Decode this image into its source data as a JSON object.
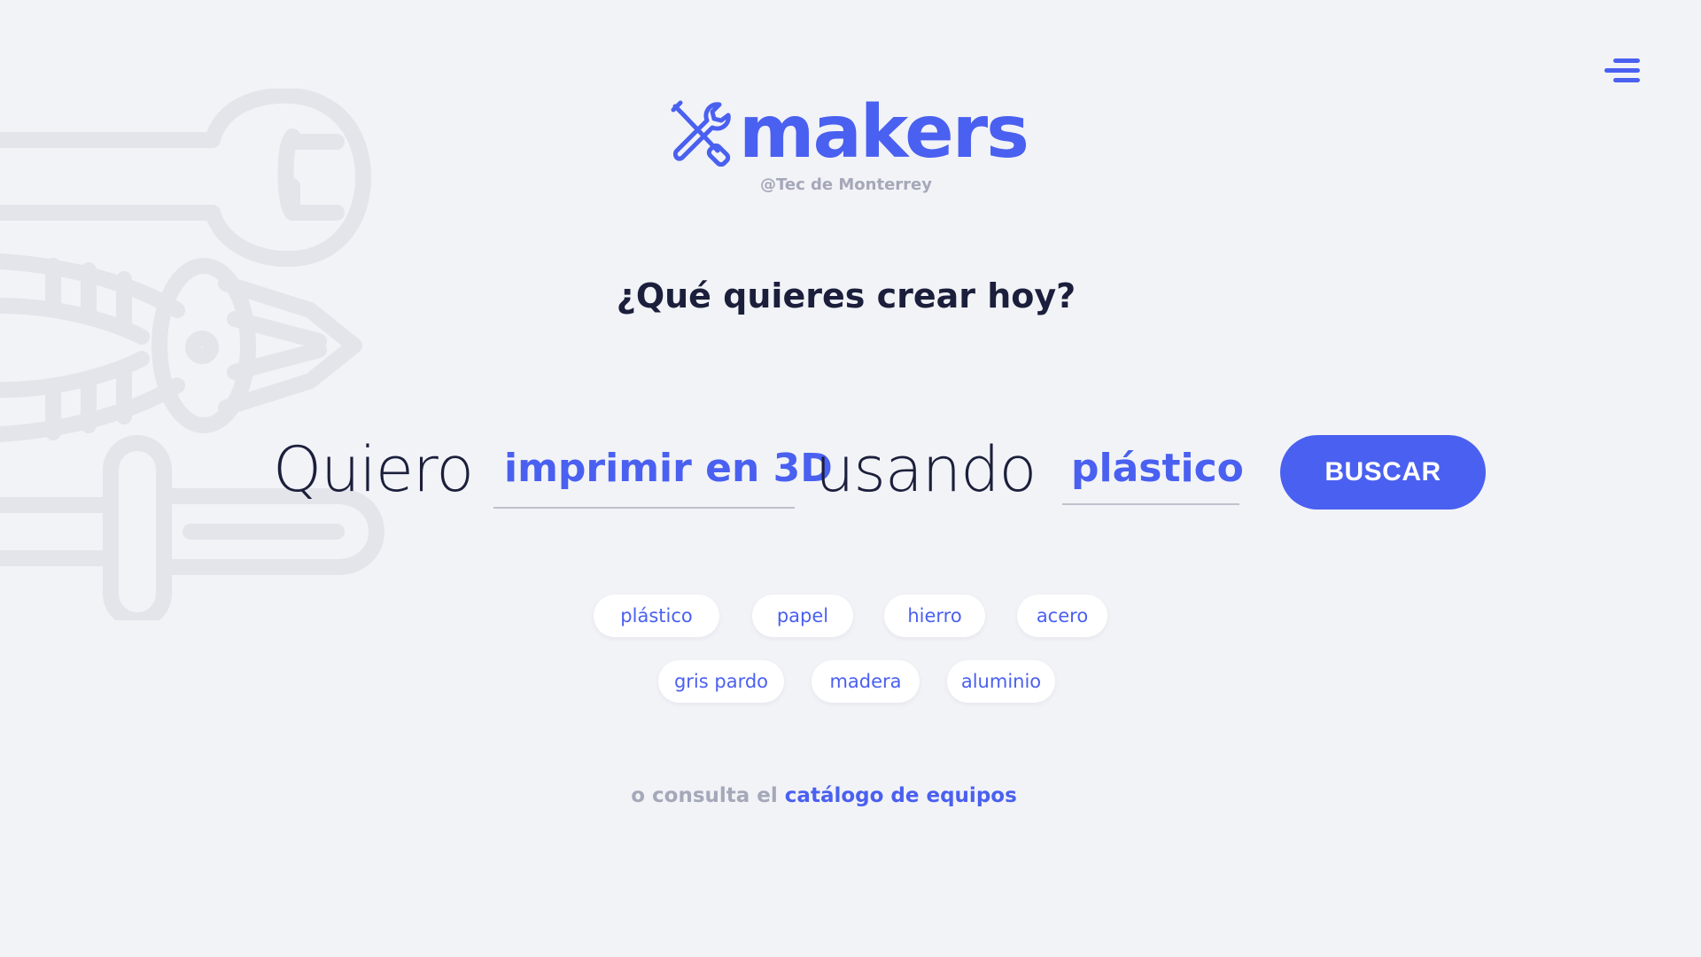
{
  "brand": {
    "name": "makers",
    "subtitle": "@Tec de Monterrey",
    "accent_color": "#4a60f0"
  },
  "menu": {
    "icon": "hamburger-menu-icon"
  },
  "hero": {
    "question": "¿Qué quieres crear hoy?",
    "word_1": "Quiero",
    "action_value": "imprimir en 3D",
    "word_2": "usando",
    "material_value": "plástico",
    "search_label": "BUSCAR"
  },
  "materials": [
    "plástico",
    "papel",
    "hierro",
    "acero",
    "gris pardo",
    "madera",
    "aluminio"
  ],
  "footer": {
    "prefix": "o consulta el",
    "link": "catálogo de equipos"
  },
  "background": {
    "icon": "tools-illustration-icon",
    "color": "#e4e6ec"
  }
}
